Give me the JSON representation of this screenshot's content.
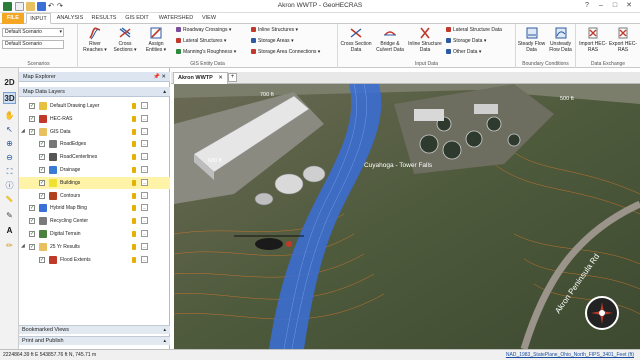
{
  "app": {
    "title": "Akron WWTP - GeoHECRAS"
  },
  "window_controls": [
    "?",
    "–",
    "□",
    "✕"
  ],
  "ribbon_tabs": [
    {
      "label": "FILE",
      "state": "file"
    },
    {
      "label": "INPUT",
      "state": "active"
    },
    {
      "label": "ANALYSIS",
      "state": ""
    },
    {
      "label": "RESULTS",
      "state": ""
    },
    {
      "label": "GIS EDIT",
      "state": ""
    },
    {
      "label": "WATERSHED",
      "state": ""
    },
    {
      "label": "VIEW",
      "state": ""
    }
  ],
  "ribbon": {
    "scenarios": {
      "group_label": "Scenarios",
      "current_scenario": "Default Scenario",
      "scenario_list_value": "Default Scenario"
    },
    "gis_entry": {
      "group_label": "GIS Entity Data",
      "big_buttons": [
        {
          "label": "River Reaches ▾",
          "icon": "river-reaches-icon",
          "color": "#c0392b"
        },
        {
          "label": "Cross Sections ▾",
          "icon": "cross-sections-icon",
          "color": "#2c5aa0"
        },
        {
          "label": "Assign Entities ▾",
          "icon": "assign-entities-icon",
          "color": "#c0392b"
        }
      ],
      "small_buttons": [
        {
          "label": "Roadway Crossings ▾",
          "icon": "roadway-crossings-icon",
          "color": "#7a4c9c"
        },
        {
          "label": "Lateral Structures ▾",
          "icon": "lateral-structures-icon",
          "color": "#c0392b"
        },
        {
          "label": "Manning's Roughness ▾",
          "icon": "mannings-roughness-icon",
          "color": "#2c8a3c"
        },
        {
          "label": "Inline Structures ▾",
          "icon": "inline-structures-icon",
          "color": "#c0392b"
        },
        {
          "label": "Storage Areas ▾",
          "icon": "storage-areas-icon",
          "color": "#2c5aa0"
        },
        {
          "label": "Storage Area Connections ▾",
          "icon": "storage-area-connections-icon",
          "color": "#c0392b"
        }
      ]
    },
    "input_data": {
      "group_label": "Input Data",
      "big_buttons": [
        {
          "label": "Cross Section Data",
          "icon": "cross-section-data-icon",
          "color": "#c0392b"
        },
        {
          "label": "Bridge & Culvert Data",
          "icon": "bridge-culvert-data-icon",
          "color": "#c0392b"
        },
        {
          "label": "Inline Structure Data",
          "icon": "inline-structure-data-icon",
          "color": "#c0392b"
        }
      ],
      "small_buttons": [
        {
          "label": "Lateral Structure Data",
          "icon": "lateral-structure-data-icon",
          "color": "#c0392b"
        },
        {
          "label": "Storage Data ▾",
          "icon": "storage-data-icon",
          "color": "#2c5aa0"
        },
        {
          "label": "Other Data ▾",
          "icon": "other-data-icon",
          "color": "#2c5aa0"
        }
      ]
    },
    "boundary": {
      "group_label": "Boundary Conditions",
      "big_buttons": [
        {
          "label": "Steady Flow Data",
          "icon": "steady-flow-icon",
          "color": "#2c5aa0"
        },
        {
          "label": "Unsteady Flow Data",
          "icon": "unsteady-flow-icon",
          "color": "#2c5aa0"
        }
      ]
    },
    "exchange": {
      "group_label": "Data Exchange",
      "big_buttons": [
        {
          "label": "Import HEC-RAS",
          "icon": "import-hecras-icon",
          "color": "#c0392b"
        },
        {
          "label": "Export HEC-RAS",
          "icon": "export-hecras-icon",
          "color": "#c0392b"
        }
      ]
    }
  },
  "left_toolbar": {
    "view_2d": "2D",
    "view_3d": "3D",
    "tools": [
      {
        "icon": "pan-hand-icon",
        "glyph": "✋"
      },
      {
        "icon": "select-arrow-icon",
        "glyph": "↖"
      },
      {
        "icon": "zoom-in-icon",
        "glyph": "⊕"
      },
      {
        "icon": "zoom-out-icon",
        "glyph": "⊖"
      },
      {
        "icon": "zoom-extent-icon",
        "glyph": "⛶"
      },
      {
        "icon": "identify-icon",
        "glyph": "ⓘ"
      },
      {
        "icon": "measure-icon",
        "glyph": "📏"
      },
      {
        "icon": "draw-line-icon",
        "glyph": "✎"
      },
      {
        "icon": "text-annotation-icon",
        "glyph": "A"
      },
      {
        "icon": "label-icon",
        "glyph": "✏"
      }
    ]
  },
  "map_explorer": {
    "title": "Map Explorer",
    "pin": "📌 ✕",
    "layers_header": "Map Data Layers",
    "layers": [
      {
        "label": "Default Drawing Layer",
        "level": 0,
        "icon": "drawing-layer-icon",
        "color": "#e8c040",
        "checked": true,
        "expand": ""
      },
      {
        "label": "HEC-RAS",
        "level": 0,
        "icon": "hecras-layer-icon",
        "color": "#c0392b",
        "checked": true,
        "expand": ""
      },
      {
        "label": "GIS Data",
        "level": 0,
        "icon": "folder-icon",
        "color": "#e8c060",
        "checked": true,
        "expand": "◢"
      },
      {
        "label": "RoadEdges",
        "level": 1,
        "icon": "roadedges-layer-icon",
        "color": "#777777",
        "checked": true,
        "expand": ""
      },
      {
        "label": "RoadCenterlines",
        "level": 1,
        "icon": "roadcenterlines-layer-icon",
        "color": "#555555",
        "checked": true,
        "expand": ""
      },
      {
        "label": "Drainage",
        "level": 1,
        "icon": "drainage-layer-icon",
        "color": "#3a7bd5",
        "checked": true,
        "expand": ""
      },
      {
        "label": "Buildings",
        "level": 1,
        "icon": "buildings-layer-icon",
        "color": "#f0e030",
        "checked": true,
        "expand": "",
        "selected": true
      },
      {
        "label": "Contours",
        "level": 1,
        "icon": "contours-layer-icon",
        "color": "#b04020",
        "checked": true,
        "expand": ""
      },
      {
        "label": "Hybrid Map Bing",
        "level": 0,
        "icon": "bing-map-icon",
        "color": "#3a6fd8",
        "checked": true,
        "expand": ""
      },
      {
        "label": "Recycling Center",
        "level": 0,
        "icon": "recycling-center-icon",
        "color": "#7a7a7a",
        "checked": true,
        "expand": ""
      },
      {
        "label": "Digital Terrain",
        "level": 0,
        "icon": "digital-terrain-icon",
        "color": "#4a8040",
        "checked": true,
        "expand": ""
      },
      {
        "label": "25 Yr Results",
        "level": 0,
        "icon": "folder-icon",
        "color": "#e8c060",
        "checked": true,
        "expand": "◢"
      },
      {
        "label": "Flood Extents",
        "level": 1,
        "icon": "flood-extents-icon",
        "color": "#c0392b",
        "checked": true,
        "expand": ""
      }
    ],
    "footer_1": "Bookmarked Views",
    "footer_2": "Print and Publish"
  },
  "document_tab": {
    "label": "Akron WWTP",
    "close": "✕",
    "add": "+"
  },
  "map": {
    "river_label": "Cuyahoga - Tower Falls",
    "road_label": "Akron Peninsula Rd",
    "contour_label_1": "500 ft",
    "contour_label_2": "700 ft",
    "contour_label_3": "680 ft"
  },
  "status": {
    "coordinates": "2224864.39 ft E  543857.76 ft N, 745.71 m",
    "projection": "NAD_1983_StatePlane_Ohio_North_FIPS_3401_Feet (ft)"
  }
}
